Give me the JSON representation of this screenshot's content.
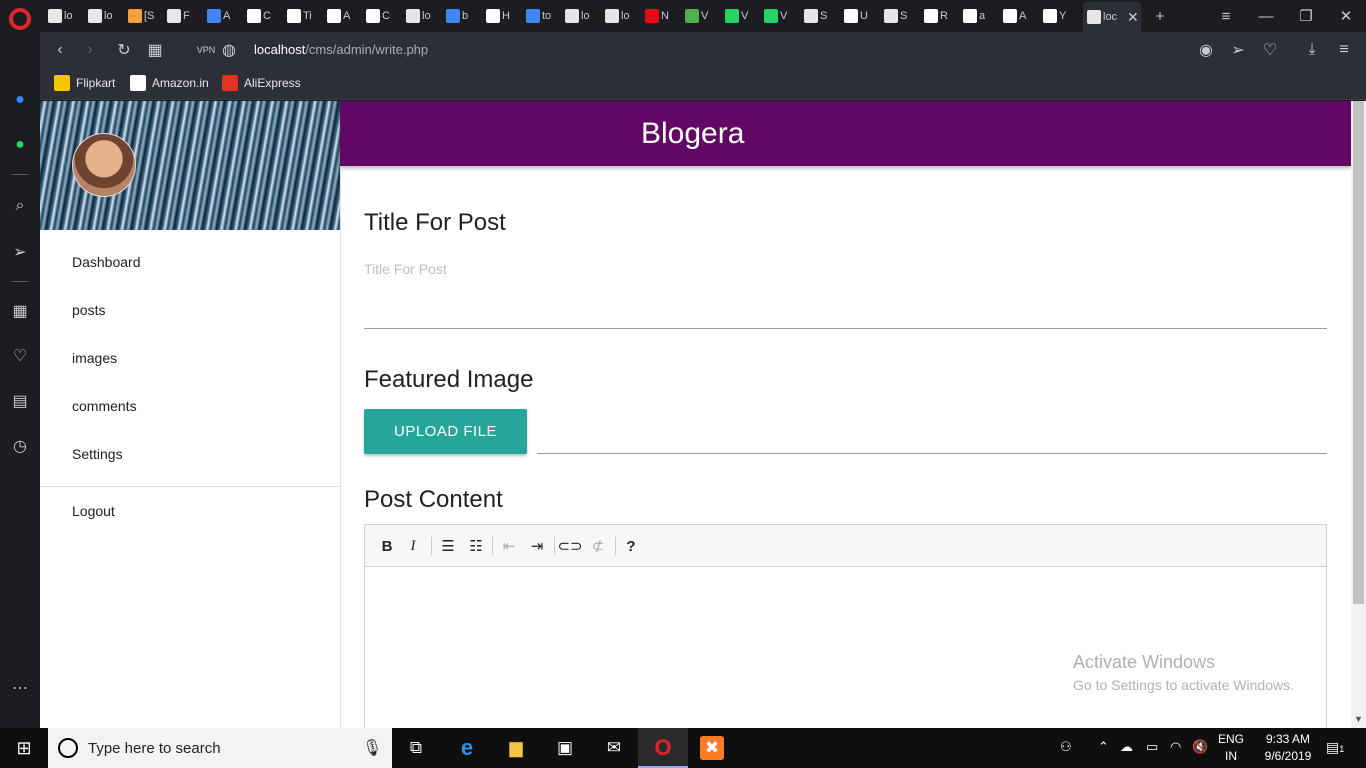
{
  "browser": {
    "url_host": "localhost",
    "url_path": "/cms/admin/write.php",
    "tabs": [
      {
        "label": "lo",
        "color": "#e6e6e6"
      },
      {
        "label": "lo",
        "color": "#e6e6e6"
      },
      {
        "label": "[S",
        "color": "#f2a03a"
      },
      {
        "label": "F",
        "color": "#e6e6e6"
      },
      {
        "label": "A",
        "color": "#4285f4"
      },
      {
        "label": "C",
        "color": "#ffffff"
      },
      {
        "label": "Ti",
        "color": "#ffffff"
      },
      {
        "label": "A",
        "color": "#ffffff"
      },
      {
        "label": "C",
        "color": "#ffffff"
      },
      {
        "label": "lo",
        "color": "#e6e6e6"
      },
      {
        "label": "b",
        "color": "#4285f4"
      },
      {
        "label": "H",
        "color": "#ffffff"
      },
      {
        "label": "to",
        "color": "#4285f4"
      },
      {
        "label": "lo",
        "color": "#e6e6e6"
      },
      {
        "label": "lo",
        "color": "#e6e6e6"
      },
      {
        "label": "N",
        "color": "#e50914"
      },
      {
        "label": "V",
        "color": "#4caf50"
      },
      {
        "label": "V",
        "color": "#25d366"
      },
      {
        "label": "V",
        "color": "#25d366"
      },
      {
        "label": "S",
        "color": "#e6e6e6"
      },
      {
        "label": "U",
        "color": "#ffffff"
      },
      {
        "label": "S",
        "color": "#e6e6e6"
      },
      {
        "label": "R",
        "color": "#ffffff"
      },
      {
        "label": "a",
        "color": "#ffffff"
      },
      {
        "label": "A",
        "color": "#ffffff"
      },
      {
        "label": "Y",
        "color": "#ffffff"
      }
    ],
    "active_tab": {
      "label": "loc"
    },
    "bookmarks": [
      {
        "label": "Flipkart",
        "color": "#f7c600"
      },
      {
        "label": "Amazon.in",
        "color": "#ffffff"
      },
      {
        "label": "AliExpress",
        "color": "#e43225"
      }
    ]
  },
  "app": {
    "brand": "Blogera",
    "brand_color": "#620764",
    "nav": [
      "Dashboard",
      "posts",
      "images",
      "comments",
      "Settings"
    ],
    "logout": "Logout"
  },
  "form": {
    "title_heading": "Title For Post",
    "title_placeholder": "Title For Post",
    "image_heading": "Featured Image",
    "upload_label": "UPLOAD FILE",
    "upload_color": "#26a69a",
    "content_heading": "Post Content"
  },
  "watermark": {
    "line1": "Activate Windows",
    "line2": "Go to Settings to activate Windows."
  },
  "taskbar": {
    "search_placeholder": "Type here to search",
    "lang_line1": "ENG",
    "lang_line2": "IN",
    "time": "9:33 AM",
    "date": "9/6/2019",
    "notification_count": "1"
  }
}
